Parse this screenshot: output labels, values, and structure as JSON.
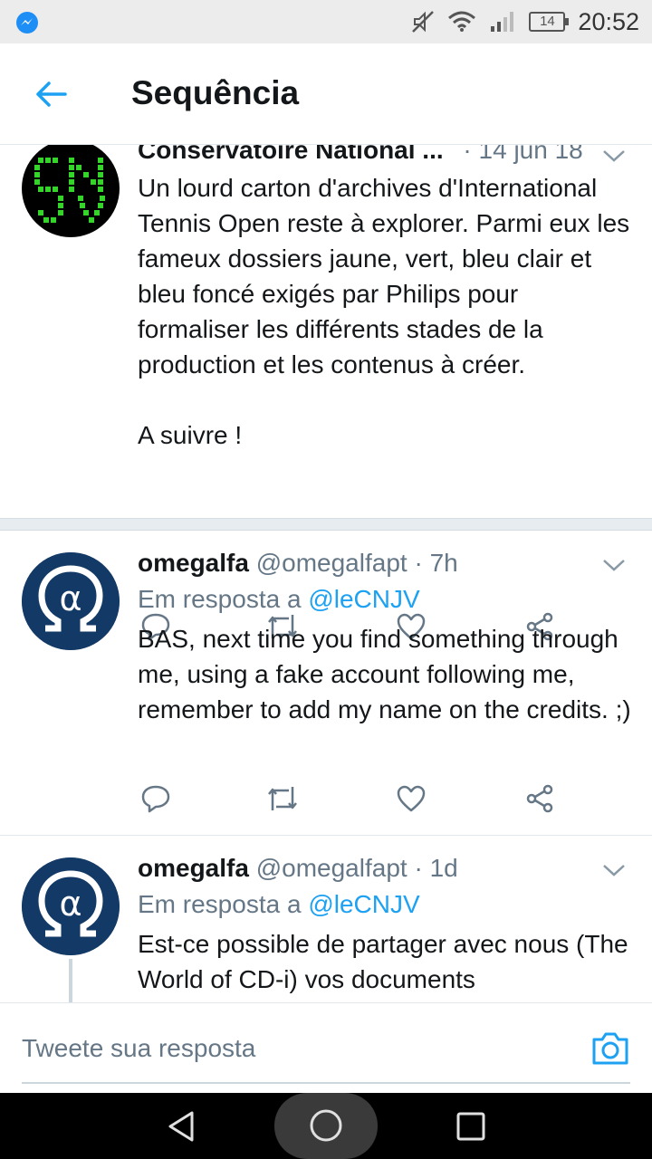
{
  "status_bar": {
    "time": "20:52",
    "battery": "14",
    "icons": [
      "messenger-icon",
      "mute-icon",
      "wifi-icon",
      "signal-icon",
      "battery-icon"
    ]
  },
  "app_bar": {
    "title": "Sequência",
    "back_icon": "arrow-left-icon"
  },
  "tweets": [
    {
      "name": "Conservatoire National ...",
      "handle": "",
      "time": "· 14 jun 18",
      "reply_prefix": "",
      "reply_handle": "",
      "text": "Un lourd carton d'archives d'International Tennis Open reste à explorer. Parmi eux les fameux dossiers jaune, vert, bleu clair et bleu foncé exigés par Philips pour formaliser les différents stades de la production et les contenus à créer.\n\nA suivre !"
    },
    {
      "name": "omegalfa",
      "handle": "@omegalfapt",
      "time": "· 7h",
      "reply_prefix": "Em resposta a",
      "reply_handle": "@leCNJV",
      "text": "BAS, next time you find something through me, using a fake account following me, remember to add my name on the credits. ;)"
    },
    {
      "name": "omegalfa",
      "handle": "@omegalfapt",
      "time": "· 1d",
      "reply_prefix": "Em resposta a",
      "reply_handle": "@leCNJV",
      "text": "Est-ce possible de partager avec nous (The World of CD-i) vos documents"
    }
  ],
  "composer": {
    "placeholder": "Tweete sua resposta",
    "camera_icon": "camera-icon"
  },
  "colors": {
    "accent": "#1da1f2",
    "secondary_text": "#657786",
    "primary_text": "#14171a",
    "divider": "#e6ecf0",
    "cnjv_green": "#35d42a",
    "omegalfa_blue": "#133a66"
  }
}
